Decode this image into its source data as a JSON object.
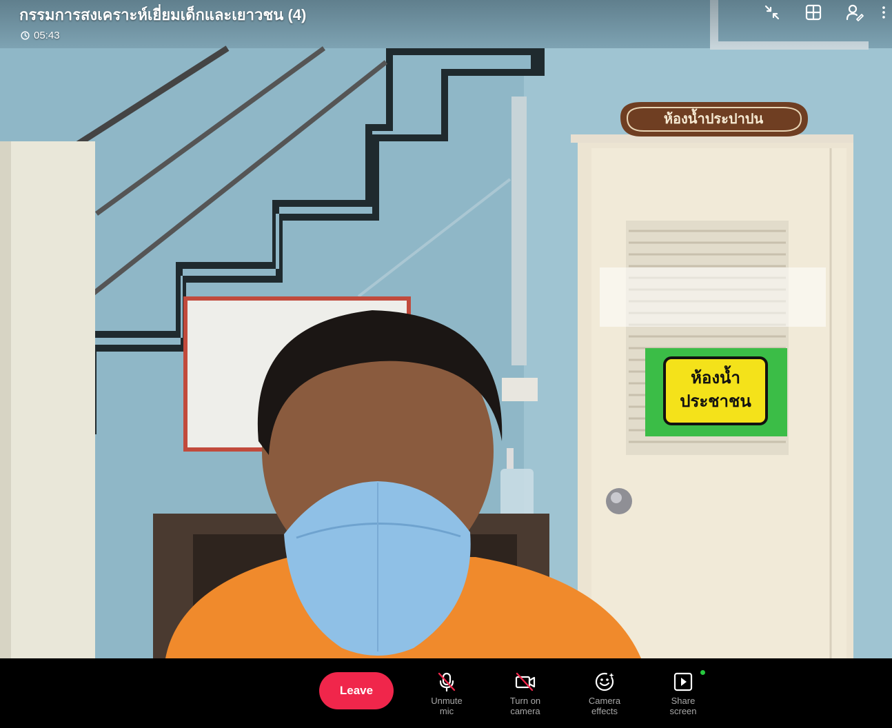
{
  "meeting": {
    "title": "กรรมการสงเคราะห์เยี่ยมเด็กและเยาวชน (4)",
    "elapsed_time": "05:43"
  },
  "scene_signs": {
    "wooden_sign": "ห้องน้ำประปาปน",
    "green_sign_line1": "ห้องน้ำ",
    "green_sign_line2": "ประชาชน"
  },
  "top_icons": [
    {
      "name": "minimize-icon"
    },
    {
      "name": "grid-layout-icon"
    },
    {
      "name": "participants-icon"
    },
    {
      "name": "more-options-icon"
    }
  ],
  "controls": {
    "leave_label": "Leave",
    "unmute_line1": "Unmute",
    "unmute_line2": "mic",
    "camera_line1": "Turn on",
    "camera_line2": "camera",
    "effects_line1": "Camera",
    "effects_line2": "effects",
    "share_line1": "Share",
    "share_line2": "screen"
  },
  "colors": {
    "leave": "#f0264b",
    "mute_slash": "#f0264b",
    "status_dot": "#27c93f"
  }
}
